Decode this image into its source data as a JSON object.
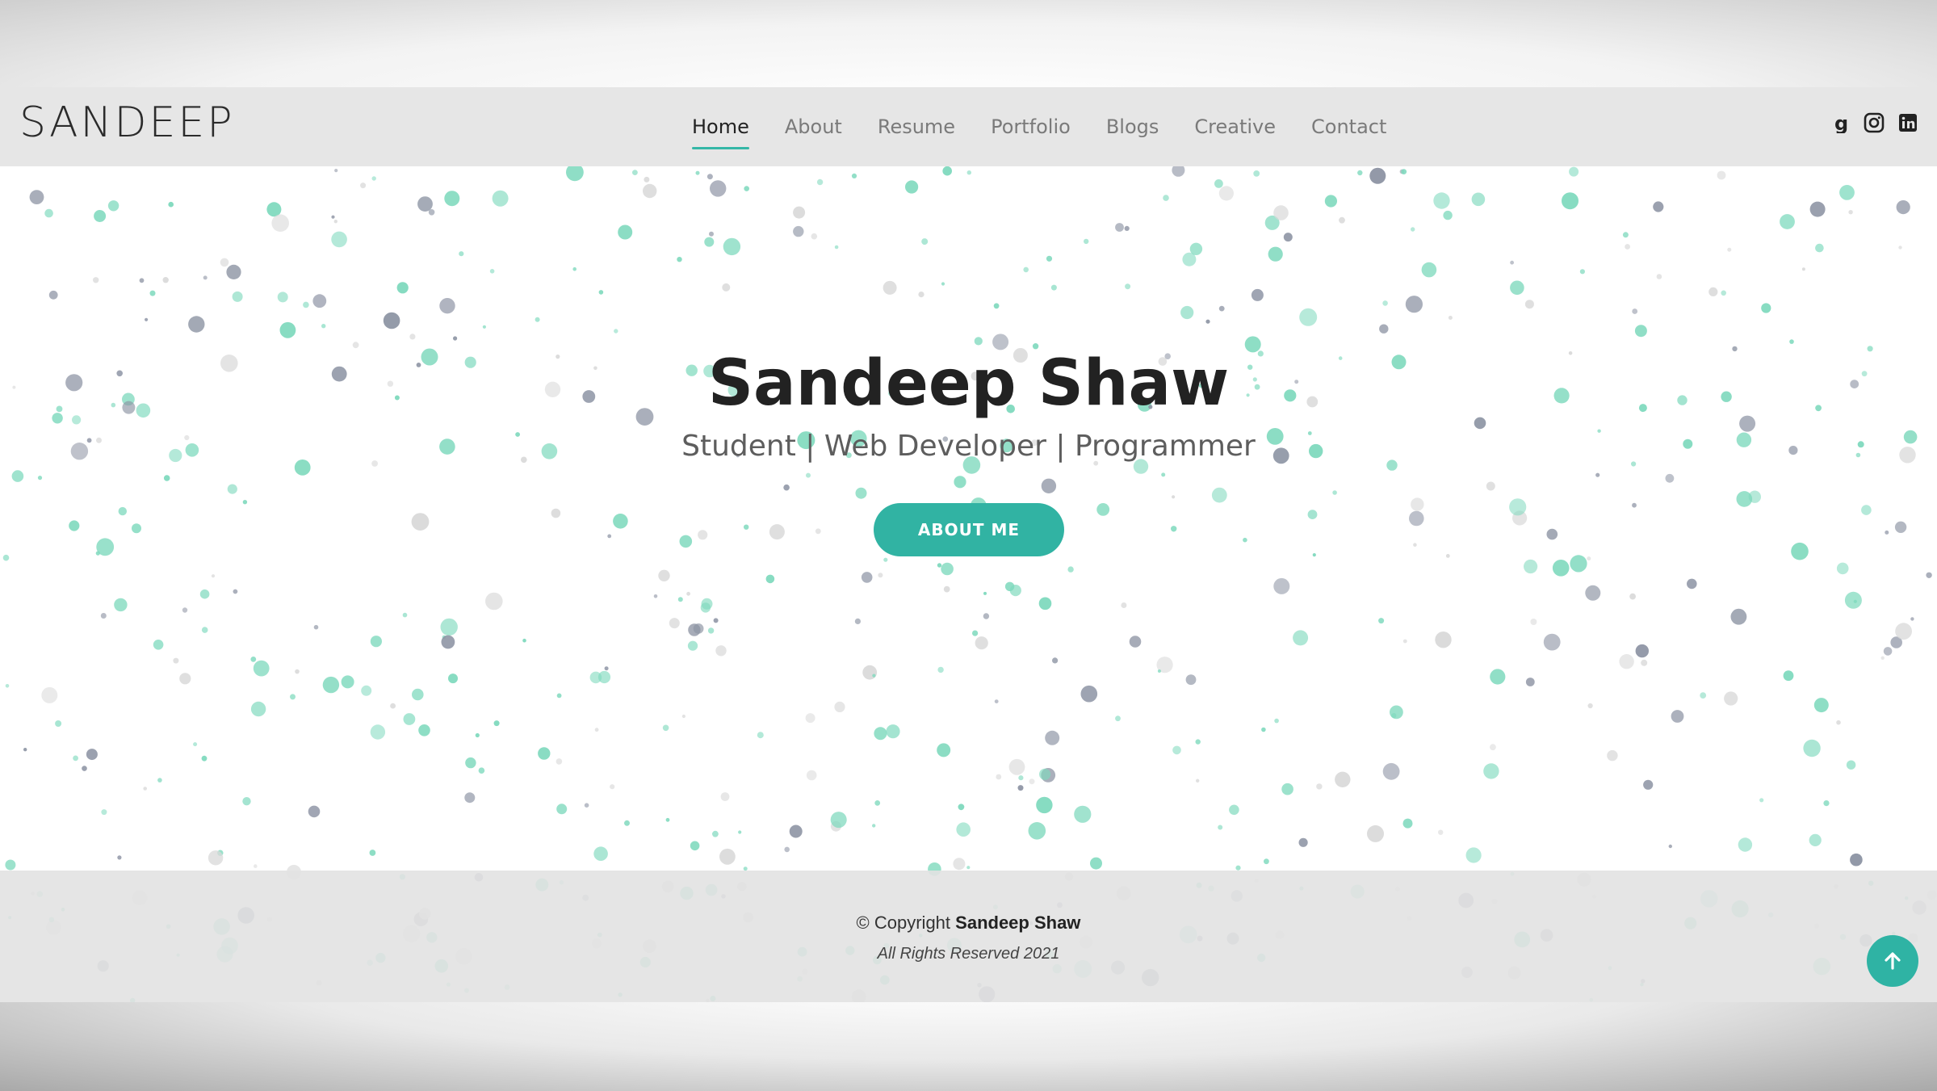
{
  "brand": {
    "logo_text": "SANDEEP"
  },
  "nav": {
    "items": [
      {
        "label": "Home",
        "active": true
      },
      {
        "label": "About",
        "active": false
      },
      {
        "label": "Resume",
        "active": false
      },
      {
        "label": "Portfolio",
        "active": false
      },
      {
        "label": "Blogs",
        "active": false
      },
      {
        "label": "Creative",
        "active": false
      },
      {
        "label": "Contact",
        "active": false
      }
    ]
  },
  "social": [
    "github-icon",
    "instagram-icon",
    "linkedin-icon"
  ],
  "hero": {
    "title": "Sandeep Shaw",
    "subtitle": "Student | Web Developer | Programmer",
    "button_label": "ABOUT ME"
  },
  "footer": {
    "copyright_prefix": "© Copyright",
    "copyright_name": "Sandeep Shaw",
    "rights": "All Rights Reserved 2021"
  },
  "colors": {
    "accent": "#31b3a3",
    "particle_green": "#7ed9bd",
    "particle_gray": "#8c93a3",
    "particle_light": "#d9d9d9"
  }
}
